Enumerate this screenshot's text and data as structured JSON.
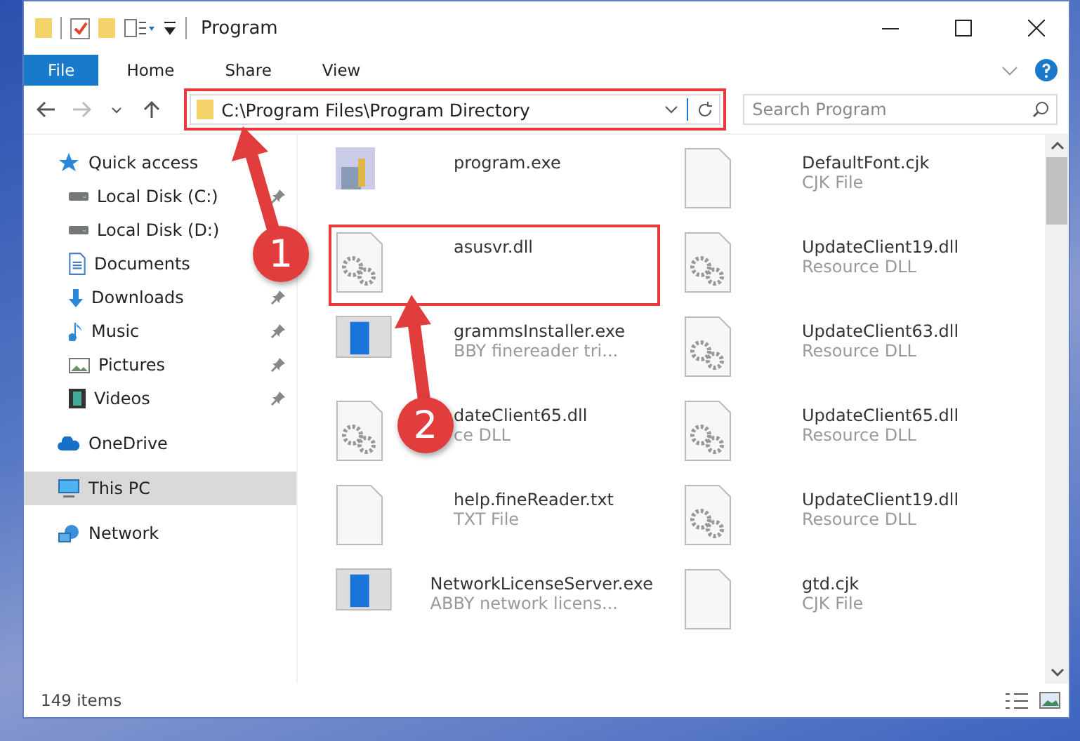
{
  "window": {
    "title": "Program"
  },
  "ribbon_tabs": [
    {
      "label": "File",
      "selected": true
    },
    {
      "label": "Home",
      "selected": false
    },
    {
      "label": "Share",
      "selected": false
    },
    {
      "label": "View",
      "selected": false
    }
  ],
  "address": {
    "value": "C:\\Program Files\\Program Directory",
    "highlighted": true
  },
  "search": {
    "placeholder": "Search Program"
  },
  "sidebar": {
    "items": [
      {
        "label": "Quick access",
        "kind": "star",
        "selected": false,
        "children": [
          {
            "label": "Local Disk (C:)",
            "kind": "drive",
            "pinned": true
          },
          {
            "label": "Local Disk (D:)",
            "kind": "drive",
            "pinned": false
          },
          {
            "label": "Documents",
            "kind": "document",
            "pinned": false
          },
          {
            "label": "Downloads",
            "kind": "download",
            "pinned": true
          },
          {
            "label": "Music",
            "kind": "music",
            "pinned": true
          },
          {
            "label": "Pictures",
            "kind": "pictures",
            "pinned": true
          },
          {
            "label": "Videos",
            "kind": "videos",
            "pinned": true
          }
        ]
      },
      {
        "label": "OneDrive",
        "kind": "cloud",
        "selected": false
      },
      {
        "label": "This PC",
        "kind": "pc",
        "selected": true
      },
      {
        "label": "Network",
        "kind": "network",
        "selected": false
      }
    ]
  },
  "files": [
    {
      "name": "program.exe",
      "kind": "program",
      "highlighted": false
    },
    {
      "name": "DefaultFont.cjk",
      "type": "CJK File",
      "kind": "blank",
      "highlighted": false
    },
    {
      "name": "asusvr.dll",
      "kind": "gear",
      "highlighted": true
    },
    {
      "name": "UpdateClient19.dll",
      "type": "Resource DLL",
      "kind": "gear",
      "highlighted": false
    },
    {
      "name": "grammsInstaller.exe",
      "type": "BBY finereader tri...",
      "kind": "app",
      "highlighted": false
    },
    {
      "name": "UpdateClient63.dll",
      "type": "Resource DLL",
      "kind": "gear",
      "highlighted": false
    },
    {
      "name": "dateClient65.dll",
      "type": "ce DLL",
      "kind": "gear",
      "highlighted": false
    },
    {
      "name": "UpdateClient65.dll",
      "type": "Resource DLL",
      "kind": "gear",
      "highlighted": false
    },
    {
      "name": "help.fineReader.txt",
      "type": "TXT File",
      "kind": "blank",
      "highlighted": false
    },
    {
      "name": "UpdateClient19.dll",
      "type": "Resource DLL",
      "kind": "gear",
      "highlighted": false
    },
    {
      "name": "NetworkLicenseServer.exe",
      "type": "ABBY network licens...",
      "kind": "app",
      "highlighted": false
    },
    {
      "name": "gtd.cjk",
      "type": "CJK File",
      "kind": "blank",
      "highlighted": false
    }
  ],
  "status_bar": {
    "count": "149 items"
  },
  "annotations": [
    {
      "number": "1"
    },
    {
      "number": "2"
    }
  ]
}
